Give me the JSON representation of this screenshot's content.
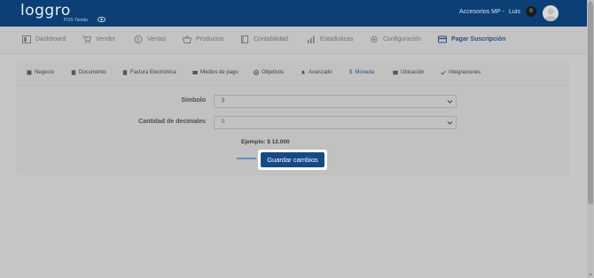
{
  "header": {
    "logo_text": "loggro",
    "logo_tagline": "POS Tienda",
    "store_selector": "Accesorios MP -",
    "user_name": "Luis",
    "notification_count": "0"
  },
  "main_nav": {
    "items": [
      {
        "label": "Dashboard",
        "icon": "dashboard-icon"
      },
      {
        "label": "Vender",
        "icon": "cart-icon"
      },
      {
        "label": "Ventas",
        "icon": "dollar-circle-icon"
      },
      {
        "label": "Productos",
        "icon": "basket-icon"
      },
      {
        "label": "Contabilidad",
        "icon": "book-icon"
      },
      {
        "label": "Estadisticas",
        "icon": "bar-chart-icon"
      },
      {
        "label": "Configuración",
        "icon": "gear-icon"
      },
      {
        "label": "Pagar Suscripción",
        "icon": "credit-card-icon"
      }
    ]
  },
  "settings_tabs": {
    "items": [
      {
        "label": "Negocio"
      },
      {
        "label": "Documento"
      },
      {
        "label": "Factura Electrónica"
      },
      {
        "label": "Medios de pago"
      },
      {
        "label": "Objetivos"
      },
      {
        "label": "Avanzado"
      },
      {
        "label": "Moneda"
      },
      {
        "label": "Ubicación"
      },
      {
        "label": "Integraciones"
      }
    ],
    "active": "Moneda"
  },
  "form": {
    "symbol_label": "Simbolo",
    "symbol_value": "$",
    "decimals_label": "Cantidad de decimales",
    "decimals_value": "0",
    "example_text": "Ejemplo: $ 12.000",
    "save_label": "Guardar cambios"
  },
  "colors": {
    "header_bg": "#0b3f75",
    "accent": "#164a86",
    "overlay_bg": "#c6c6c6"
  }
}
